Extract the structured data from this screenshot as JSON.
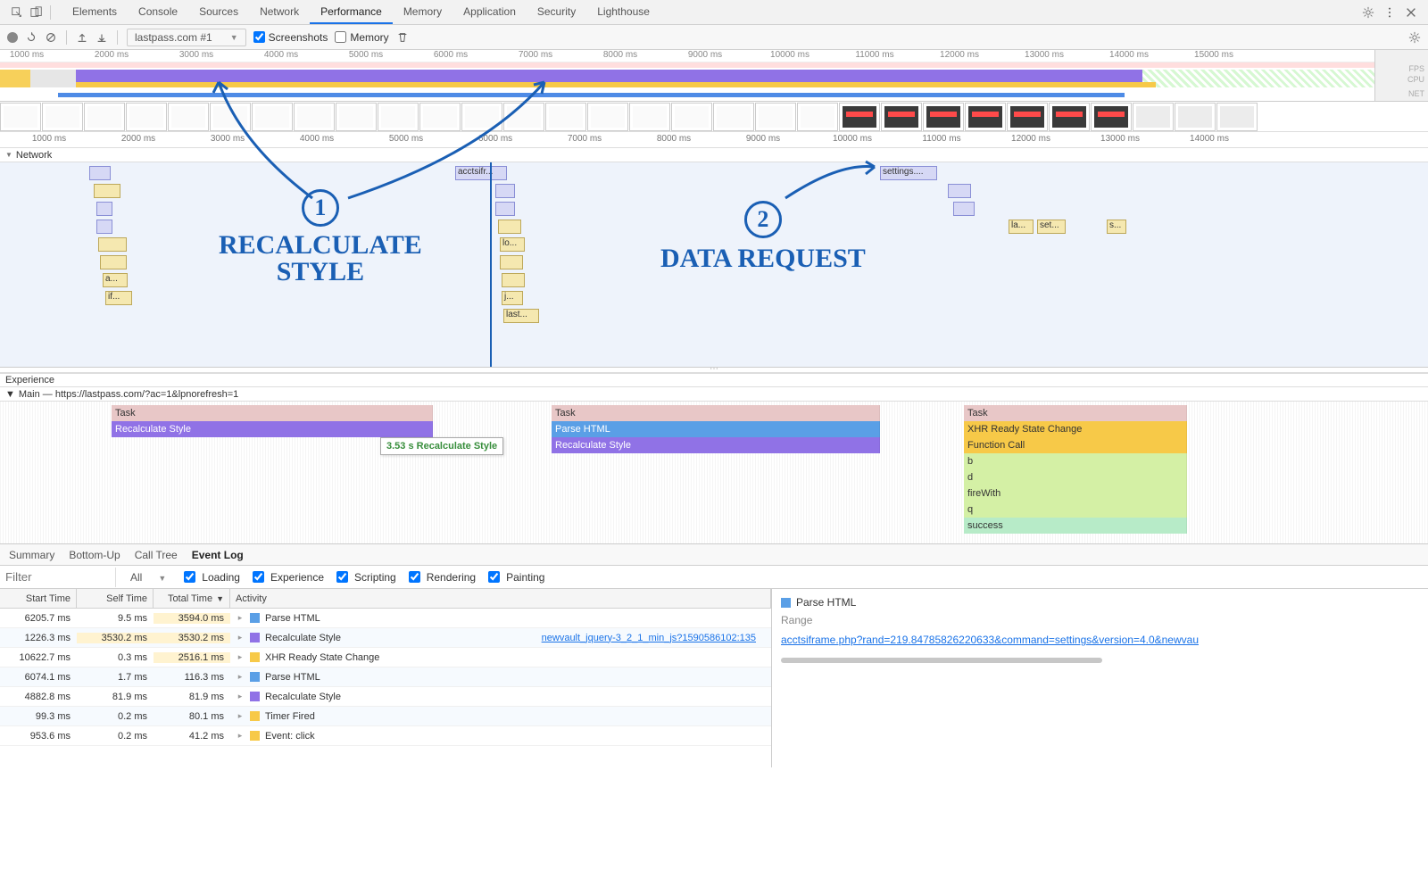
{
  "tabs": {
    "items": [
      "Elements",
      "Console",
      "Sources",
      "Network",
      "Performance",
      "Memory",
      "Application",
      "Security",
      "Lighthouse"
    ],
    "active": 4
  },
  "toolbar": {
    "page_sel": "lastpass.com #1",
    "screenshots": "Screenshots",
    "memory": "Memory"
  },
  "overview": {
    "ticks": [
      "1000 ms",
      "2000 ms",
      "3000 ms",
      "4000 ms",
      "5000 ms",
      "6000 ms",
      "7000 ms",
      "8000 ms",
      "9000 ms",
      "10000 ms",
      "11000 ms",
      "12000 ms",
      "13000 ms",
      "14000 ms",
      "15000 ms"
    ],
    "fps": "FPS",
    "cpu": "CPU",
    "net": "NET"
  },
  "timeline_ticks": [
    "1000 ms",
    "2000 ms",
    "3000 ms",
    "4000 ms",
    "5000 ms",
    "6000 ms",
    "7000 ms",
    "8000 ms",
    "9000 ms",
    "10000 ms",
    "11000 ms",
    "12000 ms",
    "13000 ms",
    "14000 ms"
  ],
  "sections": {
    "network": "Network",
    "experience": "Experience",
    "main": "Main — https://lastpass.com/?ac=1&lpnorefresh=1"
  },
  "net_items": {
    "acctsifr": "acctsifr...",
    "settings": "settings....",
    "lo": "lo...",
    "j": "j...",
    "last": "last...",
    "a": "a...",
    "if": "if...",
    "la": "la...",
    "set": "set...",
    "s": "s..."
  },
  "flame": {
    "task": "Task",
    "recalc": "Recalculate Style",
    "parse": "Parse HTML",
    "xhr": "XHR Ready State Change",
    "fn": "Function Call",
    "b": "b",
    "d": "d",
    "fw": "fireWith",
    "q": "q",
    "succ": "success"
  },
  "tooltip": "3.53 s Recalculate Style",
  "detail_tabs": [
    "Summary",
    "Bottom-Up",
    "Call Tree",
    "Event Log"
  ],
  "detail_active": 3,
  "filter": {
    "placeholder": "Filter",
    "all": "All",
    "loading": "Loading",
    "experience": "Experience",
    "scripting": "Scripting",
    "rendering": "Rendering",
    "painting": "Painting"
  },
  "table": {
    "headers": {
      "start": "Start Time",
      "self": "Self Time",
      "total": "Total Time",
      "activity": "Activity"
    },
    "sort_col": "total",
    "rows": [
      {
        "start": "6205.7 ms",
        "self": "9.5 ms",
        "total": "3594.0 ms",
        "color": "#5a9fe6",
        "label": "Parse HTML",
        "self_hl": false,
        "tot_hl": true,
        "link": ""
      },
      {
        "start": "1226.3 ms",
        "self": "3530.2 ms",
        "total": "3530.2 ms",
        "color": "#9072e6",
        "label": "Recalculate Style",
        "self_hl": true,
        "tot_hl": true,
        "link": "newvault_jquery-3_2_1_min_js?1590586102:135"
      },
      {
        "start": "10622.7 ms",
        "self": "0.3 ms",
        "total": "2516.1 ms",
        "color": "#f7c948",
        "label": "XHR Ready State Change",
        "self_hl": false,
        "tot_hl": true,
        "link": ""
      },
      {
        "start": "6074.1 ms",
        "self": "1.7 ms",
        "total": "116.3 ms",
        "color": "#5a9fe6",
        "label": "Parse HTML",
        "self_hl": false,
        "tot_hl": false,
        "link": ""
      },
      {
        "start": "4882.8 ms",
        "self": "81.9 ms",
        "total": "81.9 ms",
        "color": "#9072e6",
        "label": "Recalculate Style",
        "self_hl": false,
        "tot_hl": false,
        "link": ""
      },
      {
        "start": "99.3 ms",
        "self": "0.2 ms",
        "total": "80.1 ms",
        "color": "#f7c948",
        "label": "Timer Fired",
        "self_hl": false,
        "tot_hl": false,
        "link": ""
      },
      {
        "start": "953.6 ms",
        "self": "0.2 ms",
        "total": "41.2 ms",
        "color": "#f7c948",
        "label": "Event: click",
        "self_hl": false,
        "tot_hl": false,
        "link": ""
      }
    ]
  },
  "right_panel": {
    "icon_color": "#5a9fe6",
    "title": "Parse HTML",
    "range": "Range",
    "link": "acctsiframe.php?rand=219.84785826220633&command=settings&version=4.0&newvau"
  },
  "annotations": {
    "one_label": "RECALCULATE\nSTYLE",
    "two_label": "DATA REQUEST"
  }
}
